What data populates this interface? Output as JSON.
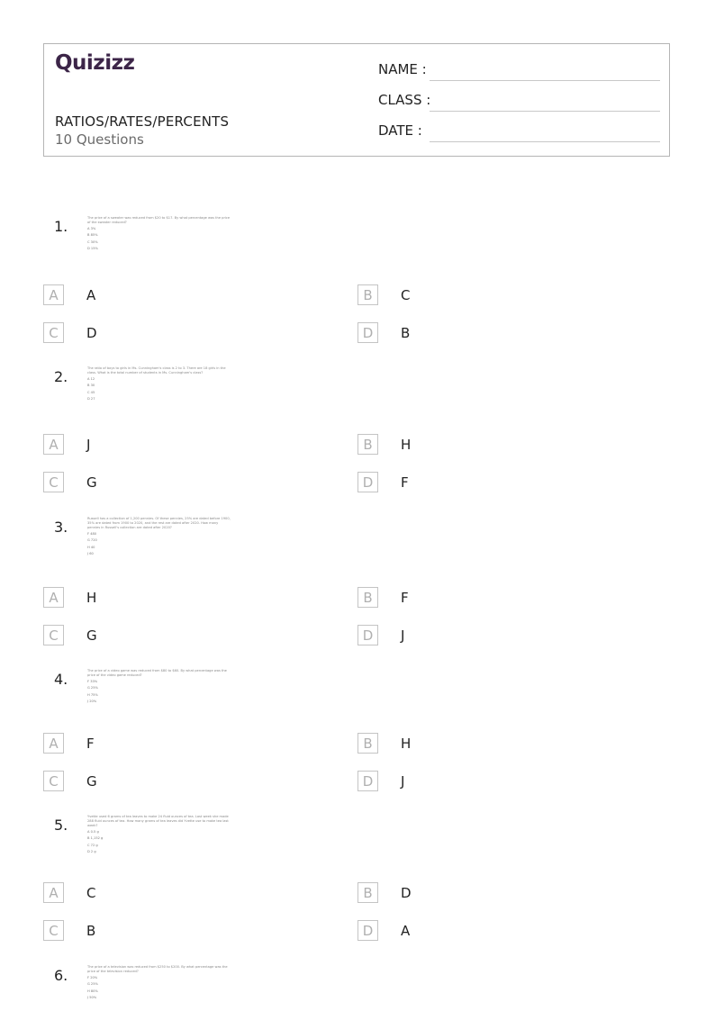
{
  "header": {
    "logo": "Quizizz",
    "title": "RATIOS/RATES/PERCENTS",
    "subtitle": "10 Questions",
    "fields": [
      {
        "label": "NAME :"
      },
      {
        "label": "CLASS :"
      },
      {
        "label": "DATE  :"
      }
    ]
  },
  "questions": [
    {
      "number": "1.",
      "image_text": {
        "stem": "The price of a sweater was reduced from $20 to $17. By what percentage was the price of the sweater reduced?",
        "options": [
          "A  3%",
          "B  85%",
          "C  30%",
          "D  15%"
        ]
      },
      "answers": [
        {
          "letter": "A",
          "text": "A"
        },
        {
          "letter": "B",
          "text": "C"
        },
        {
          "letter": "C",
          "text": "D"
        },
        {
          "letter": "D",
          "text": "B"
        }
      ]
    },
    {
      "number": "2.",
      "image_text": {
        "stem": "The ratio of boys to girls in Ms. Cunningham's class is 2 to 3. There are 18 girls in the class. What is the total number of students in Ms. Cunningham's class?",
        "options": [
          "A  12",
          "B  30",
          "C  45",
          "D  27"
        ]
      },
      "answers": [
        {
          "letter": "A",
          "text": "J"
        },
        {
          "letter": "B",
          "text": "H"
        },
        {
          "letter": "C",
          "text": "G"
        },
        {
          "letter": "D",
          "text": "F"
        }
      ]
    },
    {
      "number": "3.",
      "image_text": {
        "stem": "Russell has a collection of 1,200 pennies. Of these pennies, 25% are dated before 1900, 35% are dated from 1900 to 2020, and the rest are dated after 2020. How many pennies in Russell's collection are dated after 2020?",
        "options": [
          "F  480",
          "G  720",
          "H  40",
          "J  60"
        ]
      },
      "answers": [
        {
          "letter": "A",
          "text": "H"
        },
        {
          "letter": "B",
          "text": "F"
        },
        {
          "letter": "C",
          "text": "G"
        },
        {
          "letter": "D",
          "text": "J"
        }
      ]
    },
    {
      "number": "4.",
      "image_text": {
        "stem": "The price of a video game was reduced from $80 to $60. By what percentage was the price of the video game reduced?",
        "options": [
          "F  33%",
          "G  25%",
          "H  75%",
          "J  20%"
        ]
      },
      "answers": [
        {
          "letter": "A",
          "text": "F"
        },
        {
          "letter": "B",
          "text": "H"
        },
        {
          "letter": "C",
          "text": "G"
        },
        {
          "letter": "D",
          "text": "J"
        }
      ]
    },
    {
      "number": "5.",
      "image_text": {
        "stem": "Yvette used 6 grams of tea leaves to make 24 fluid ounces of tea. Last week she made 288 fluid ounces of tea. How many grams of tea leaves did Yvette use to make tea last week?",
        "options": [
          "A  0.5 g",
          "B  1,152 g",
          "C  72 g",
          "D  2 g"
        ]
      },
      "answers": [
        {
          "letter": "A",
          "text": "C"
        },
        {
          "letter": "B",
          "text": "D"
        },
        {
          "letter": "C",
          "text": "B"
        },
        {
          "letter": "D",
          "text": "A"
        }
      ]
    },
    {
      "number": "6.",
      "image_text": {
        "stem": "The price of a television was reduced from $250 to $200. By what percentage was the price of the television reduced?",
        "options": [
          "F  20%",
          "G  25%",
          "H  80%",
          "J  50%"
        ]
      },
      "answers": []
    }
  ]
}
